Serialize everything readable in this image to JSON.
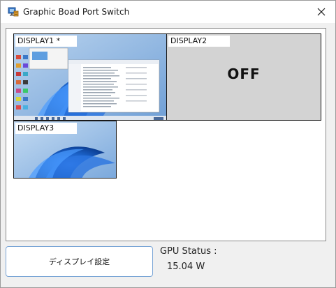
{
  "window": {
    "title": "Graphic Boad Port Switch"
  },
  "displays": [
    {
      "label": "DISPLAY1 *",
      "state": "on"
    },
    {
      "label": "DISPLAY2",
      "state": "off",
      "off_text": "OFF"
    },
    {
      "label": "DISPLAY3",
      "state": "on"
    }
  ],
  "controls": {
    "settings_button": "ディスプレイ設定"
  },
  "gpu": {
    "label": "GPU Status :",
    "value": "15.04 W"
  },
  "colors": {
    "accent": "#7aa5d6",
    "wallpaper": "#1a5fc4",
    "off_bg": "#d3d3d3"
  },
  "icons": {
    "app": "monitor-switch-icon",
    "close": "close-icon"
  }
}
